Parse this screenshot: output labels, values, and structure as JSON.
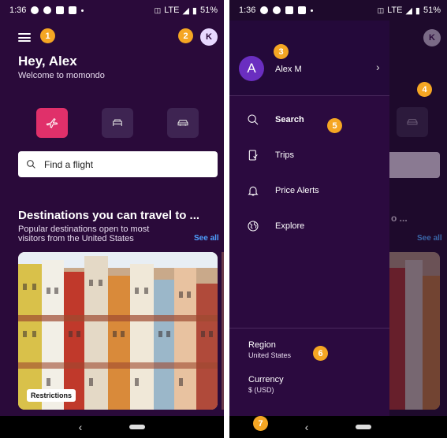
{
  "status_bar": {
    "time": "1:36",
    "network": "LTE",
    "battery": "51%"
  },
  "home": {
    "greeting": "Hey, Alex",
    "welcome": "Welcome to momondo",
    "avatar_initial": "K",
    "modes": [
      {
        "name": "flights",
        "icon": "plane-icon",
        "active": true
      },
      {
        "name": "hotels",
        "icon": "bed-icon",
        "active": false
      },
      {
        "name": "cars",
        "icon": "car-icon",
        "active": false
      }
    ],
    "search_placeholder": "Find a flight",
    "destinations_title": "Destinations you can travel to ...",
    "destinations_subtitle": "Popular destinations open to most visitors from the United States",
    "see_all": "See all",
    "restrictions_label": "Restrictions"
  },
  "drawer": {
    "avatar_initial": "A",
    "user_name": "Alex M",
    "menu": [
      {
        "label": "Search",
        "icon": "search-icon",
        "active": true
      },
      {
        "label": "Trips",
        "icon": "trips-icon",
        "active": false
      },
      {
        "label": "Price Alerts",
        "icon": "bell-icon",
        "active": false
      },
      {
        "label": "Explore",
        "icon": "globe-icon",
        "active": false
      }
    ],
    "region_title": "Region",
    "region_value": "United States",
    "currency_title": "Currency",
    "currency_value": "$ (USD)"
  },
  "peek": {
    "text": "o ...",
    "see_all": "See all",
    "avatar_initial": "K"
  },
  "annotations": [
    "1",
    "2",
    "3",
    "4",
    "5",
    "6",
    "7"
  ],
  "colors": {
    "background": "#2a0a3a",
    "accent": "#e0306a",
    "badge": "#f5a623",
    "link": "#4fa0ff"
  }
}
